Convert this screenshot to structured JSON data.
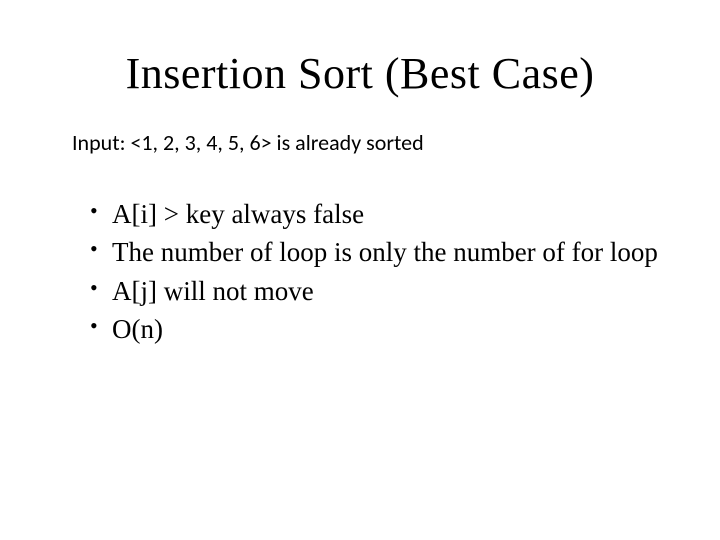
{
  "title": "Insertion Sort (Best Case)",
  "input_line": "Input:  <1, 2, 3, 4, 5, 6>   is already sorted",
  "bullets": [
    "A[i] > key always false",
    "The number of loop is only the number of for loop",
    "A[j] will not move",
    "O(n)"
  ]
}
